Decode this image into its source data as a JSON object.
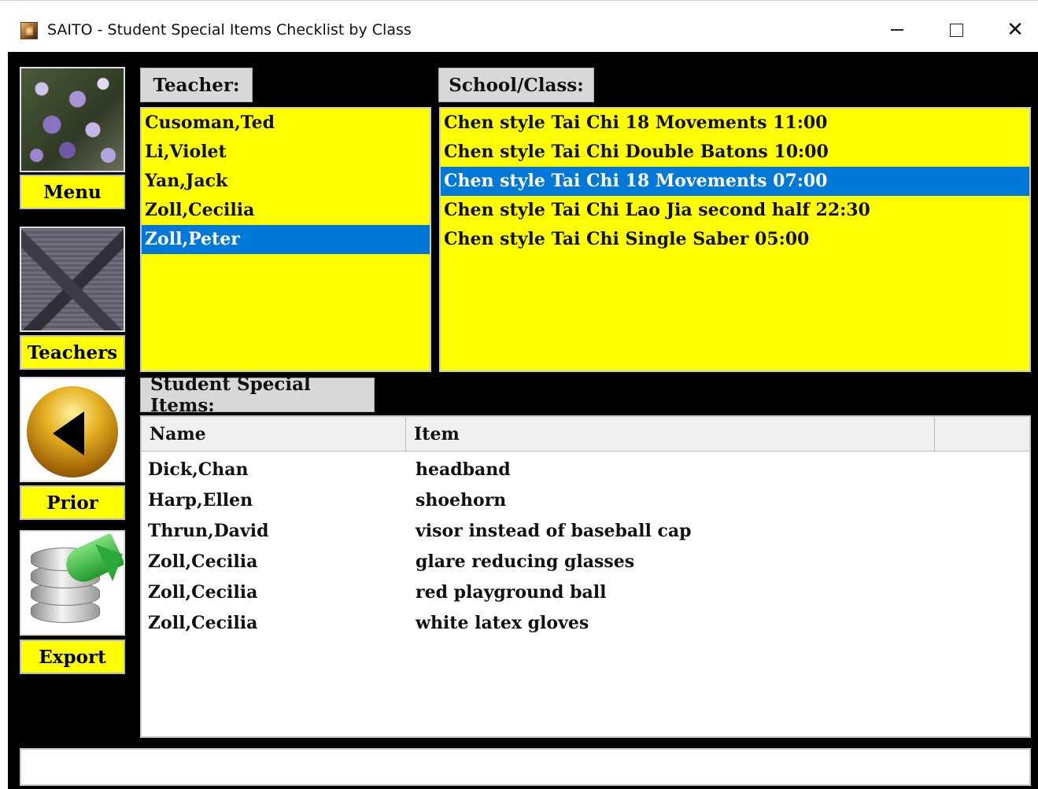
{
  "window": {
    "title": "SAITO - Student Special Items Checklist by Class",
    "minimize_icon": "minimize-icon",
    "maximize_icon": "maximize-icon",
    "close_glyph": "✕"
  },
  "sidebar": {
    "menu_label": "Menu",
    "teachers_label": "Teachers",
    "prior_label": "Prior",
    "export_label": "Export"
  },
  "teacher": {
    "header": "Teacher:",
    "items": [
      "Cusoman,Ted",
      "Li,Violet",
      "Yan,Jack",
      "Zoll,Cecilia",
      "Zoll,Peter"
    ],
    "selected_index": 4
  },
  "school_class": {
    "header": "School/Class:",
    "items": [
      "Chen style Tai Chi 18 Movements 11:00",
      "Chen style Tai Chi Double Batons 10:00",
      "Chen style Tai Chi 18 Movements 07:00",
      "Chen style Tai Chi Lao Jia second half 22:30",
      "Chen style Tai Chi Single Saber 05:00"
    ],
    "selected_index": 2
  },
  "students": {
    "header": "Student Special Items:",
    "columns": [
      "Name",
      "Item"
    ],
    "rows": [
      {
        "name": "Dick,Chan",
        "item": "headband"
      },
      {
        "name": "Harp,Ellen",
        "item": "shoehorn"
      },
      {
        "name": "Thrun,David",
        "item": "visor instead of baseball cap"
      },
      {
        "name": "Zoll,Cecilia",
        "item": "glare reducing glasses"
      },
      {
        "name": "Zoll,Cecilia",
        "item": "red playground ball"
      },
      {
        "name": "Zoll,Cecilia",
        "item": "white latex gloves"
      }
    ]
  },
  "status_bar": {
    "text": ""
  },
  "colors": {
    "list_background": "#ffff00",
    "selection": "#0078d7",
    "app_background": "#000000"
  }
}
